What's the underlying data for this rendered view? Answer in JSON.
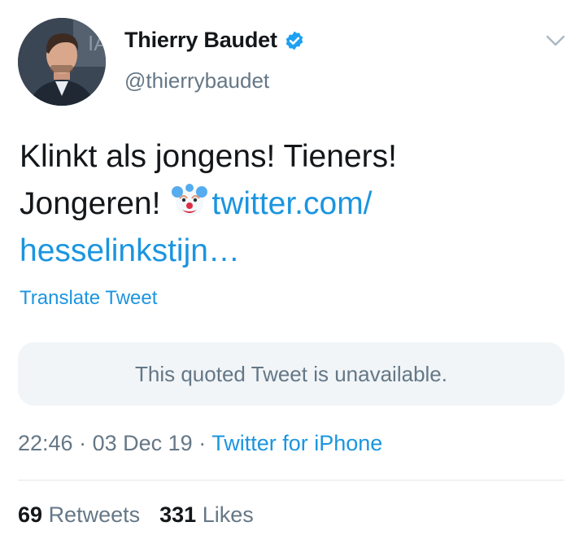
{
  "author": {
    "display_name": "Thierry Baudet",
    "handle": "@thierrybaudet",
    "verified": true,
    "avatar_icon": "profile-photo"
  },
  "tweet": {
    "text_line1": "Klinkt als jongens! Tieners!",
    "text_line2_prefix": "Jongeren!",
    "emoji": "clown-face",
    "link_part1": "twitter.com/",
    "link_part2": "hesselinkstijn…",
    "translate_label": "Translate Tweet",
    "quoted_unavailable": "This quoted Tweet is unavailable."
  },
  "meta": {
    "time": "22:46",
    "date": "03 Dec 19",
    "separator": "·",
    "source": "Twitter for iPhone"
  },
  "stats": {
    "retweets_count": "69",
    "retweets_label": "Retweets",
    "likes_count": "331",
    "likes_label": "Likes"
  },
  "colors": {
    "link": "#1b95e0",
    "secondary": "#657786",
    "primary": "#14171a",
    "quoted_bg": "#f1f5f8"
  }
}
